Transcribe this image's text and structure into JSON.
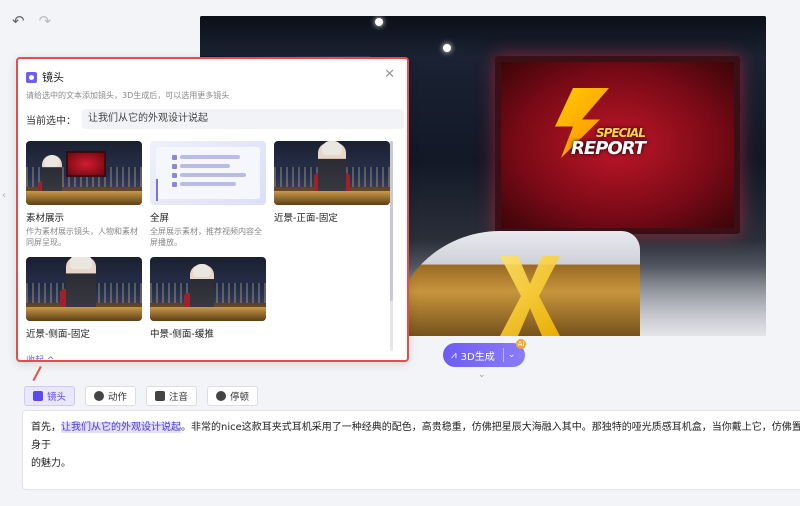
{
  "toolbar": {
    "undo_icon": "undo-icon",
    "redo_icon": "redo-icon"
  },
  "preview": {
    "screen_text_top": "SPECIAL",
    "screen_text_bottom": "REPORT"
  },
  "generate": {
    "label": "3D生成",
    "badge": "AI"
  },
  "panel": {
    "title": "镜头",
    "hint": "请给选中的文本添加镜头，3D生成后，可以选用更多镜头",
    "current_label": "当前选中：",
    "current_value": "让我们从它的外观设计说起",
    "expand": "收起 ^",
    "cards": [
      {
        "name": "素材展示",
        "desc": "作为素材展示镜头，人物和素材同屏呈现。",
        "type": "studio"
      },
      {
        "name": "全屏",
        "desc": "全屏展示素材，推荐视频内容全屏播放。",
        "type": "full"
      },
      {
        "name": "近景-正面-固定",
        "desc": "",
        "type": "closeup"
      },
      {
        "name": "近景-侧面-固定",
        "desc": "",
        "type": "side"
      },
      {
        "name": "中景-侧面-缓推",
        "desc": "",
        "type": "medium"
      }
    ]
  },
  "tabs": [
    {
      "label": "镜头",
      "active": true
    },
    {
      "label": "动作",
      "active": false
    },
    {
      "label": "注音",
      "active": false
    },
    {
      "label": "停顿",
      "active": false
    }
  ],
  "script": {
    "lead": "首先，",
    "highlight": "让我们从它的外观设计说起",
    "rest": "。非常的nice这款耳夹式耳机采用了一种经典的配色，高贵稳重，仿佛把星辰大海融入其中。那独特的哑光质感耳机盒，当你戴上它，仿佛置身于",
    "line2": "的魅力。"
  }
}
